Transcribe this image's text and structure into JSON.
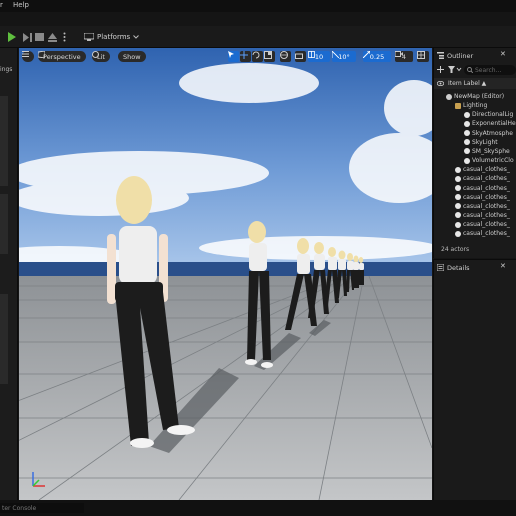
{
  "menu": {
    "items": [
      "r",
      "Help"
    ]
  },
  "toolbar": {
    "platforms_label": "Platforms"
  },
  "left_panel": {
    "label": "ings"
  },
  "viewport": {
    "view_mode": "Perspective",
    "lighting_mode": "Lit",
    "show_label": "Show",
    "grid_snap": "10",
    "rotation_snap": "10°",
    "scale_snap": "0.25",
    "camera_speed": "4"
  },
  "outliner": {
    "title": "Outliner",
    "search_placeholder": "Search...",
    "column_header": "Item Label ▲",
    "items": [
      {
        "label": "NewMap (Editor)",
        "depth": 1,
        "icon": "map-icon"
      },
      {
        "label": "Lighting",
        "depth": 2,
        "icon": "folder-icon"
      },
      {
        "label": "DirectionalLig",
        "depth": 3,
        "icon": "directional-light-icon"
      },
      {
        "label": "ExponentialHe",
        "depth": 3,
        "icon": "fog-icon"
      },
      {
        "label": "SkyAtmosphe",
        "depth": 3,
        "icon": "atmosphere-icon"
      },
      {
        "label": "SkyLight",
        "depth": 3,
        "icon": "skylight-icon"
      },
      {
        "label": "SM_SkySphe",
        "depth": 3,
        "icon": "sphere-icon"
      },
      {
        "label": "VolumetricClo",
        "depth": 3,
        "icon": "cloud-icon"
      },
      {
        "label": "casual_clothes_",
        "depth": 2,
        "icon": "character-icon"
      },
      {
        "label": "casual_clothes_",
        "depth": 2,
        "icon": "character-icon"
      },
      {
        "label": "casual_clothes_",
        "depth": 2,
        "icon": "character-icon"
      },
      {
        "label": "casual_clothes_",
        "depth": 2,
        "icon": "character-icon"
      },
      {
        "label": "casual_clothes_",
        "depth": 2,
        "icon": "character-icon"
      },
      {
        "label": "casual_clothes_",
        "depth": 2,
        "icon": "character-icon"
      },
      {
        "label": "casual_clothes_",
        "depth": 2,
        "icon": "character-icon"
      },
      {
        "label": "casual_clothes_",
        "depth": 2,
        "icon": "character-icon"
      }
    ],
    "actor_count": "24 actors"
  },
  "details": {
    "title": "Details"
  },
  "statusbar": {
    "console_placeholder": "ter Console"
  },
  "colors": {
    "accent": "#1b6bd0",
    "play": "#5fbf3f",
    "folder": "#c8a050"
  }
}
